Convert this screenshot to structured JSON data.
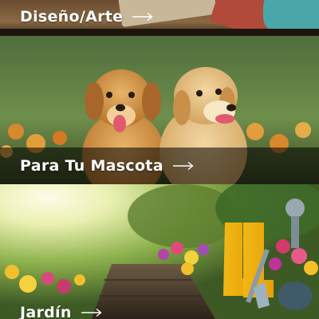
{
  "categories": [
    {
      "label": "Diseño/Arte",
      "icon": "arrow-right-icon"
    },
    {
      "label": "Para Tu Mascota",
      "icon": "arrow-right-icon"
    },
    {
      "label": "Jardín",
      "icon": "arrow-right-icon"
    }
  ],
  "colors": {
    "label_text": "#ffffff",
    "overlay": "#000000"
  }
}
